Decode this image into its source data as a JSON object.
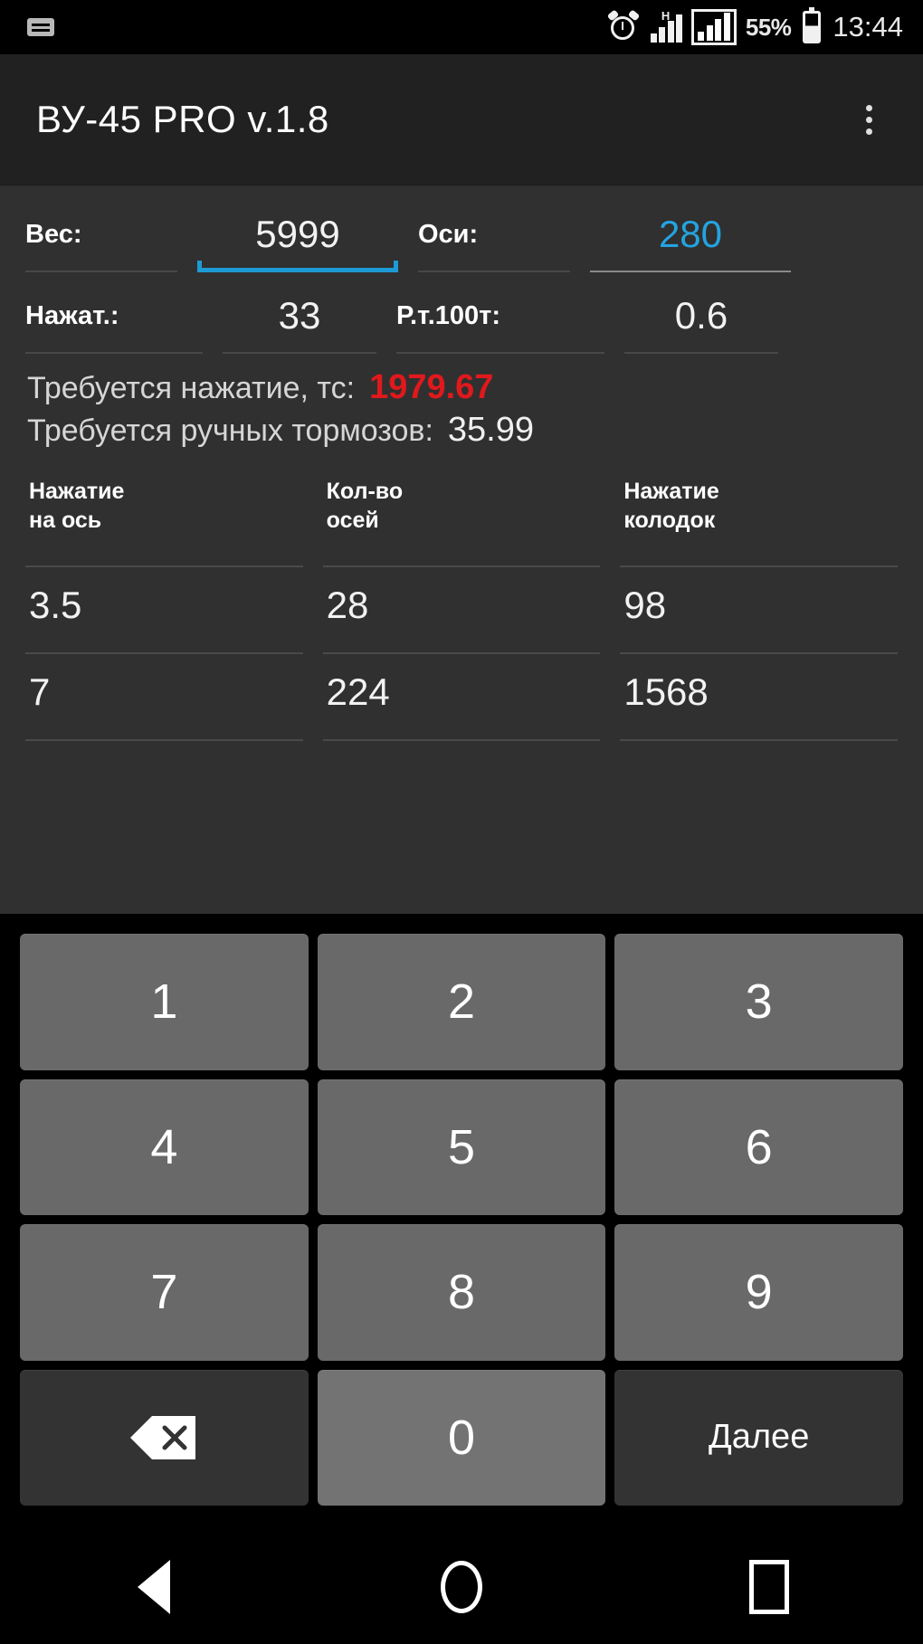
{
  "status_bar": {
    "keyboard_icon": "keyboard-icon",
    "alarm_icon": "alarm-clock-icon",
    "network_label": "H",
    "battery_percent": "55%",
    "clock": "13:44"
  },
  "app_bar": {
    "title": "ВУ-45 PRO v.1.8",
    "overflow_icon": "overflow-menu-icon"
  },
  "form": {
    "row1": {
      "label_weight": "Вес:",
      "value_weight": "5999",
      "label_axles": "Оси:",
      "value_axles": "280"
    },
    "row2": {
      "label_press": "Нажат.:",
      "value_press": "33",
      "label_rt100": "Р.т.100т:",
      "value_rt100": "0.6"
    }
  },
  "results": [
    {
      "label": "Требуется нажатие, тс:",
      "value": "1979.67",
      "color": "#e0191c"
    },
    {
      "label": "Требуется ручных тормозов:",
      "value": "35.99",
      "color": "#f0f0f0"
    }
  ],
  "table": {
    "headers": [
      "Нажатие\nна ось",
      "Кол-во\nосей",
      "Нажатие\nколодок"
    ],
    "rows": [
      [
        "3.5",
        "28",
        "98"
      ],
      [
        "7",
        "224",
        "1568"
      ]
    ]
  },
  "keypad": {
    "rows": [
      [
        "1",
        "2",
        "3"
      ],
      [
        "4",
        "5",
        "6"
      ],
      [
        "7",
        "8",
        "9"
      ]
    ],
    "backspace_icon": "backspace-icon",
    "zero": "0",
    "next_label": "Далее"
  },
  "nav_bar": {
    "back": "back-icon",
    "home": "home-icon",
    "recents": "recents-icon"
  },
  "colors": {
    "accent": "#24a4e0",
    "danger": "#e0191c",
    "app_bar_bg": "#212121",
    "content_bg": "#303030",
    "keypad_bg": "#000000",
    "key_bg": "#696969"
  }
}
